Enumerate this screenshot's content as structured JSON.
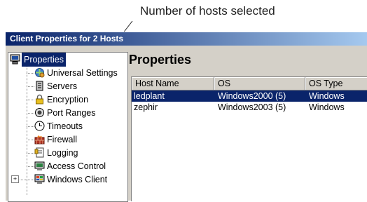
{
  "callout": {
    "text": "Number of hosts selected"
  },
  "window": {
    "title": "Client Properties for 2 Hosts"
  },
  "tree": {
    "items": [
      {
        "label": "Properties",
        "icon": "computer-icon"
      },
      {
        "label": "Universal Settings",
        "icon": "universal-settings-icon"
      },
      {
        "label": "Servers",
        "icon": "server-icon"
      },
      {
        "label": "Encryption",
        "icon": "lock-icon"
      },
      {
        "label": "Port Ranges",
        "icon": "port-icon"
      },
      {
        "label": "Timeouts",
        "icon": "clock-icon"
      },
      {
        "label": "Firewall",
        "icon": "firewall-icon"
      },
      {
        "label": "Logging",
        "icon": "log-icon"
      },
      {
        "label": "Access Control",
        "icon": "access-control-icon"
      },
      {
        "label": "Windows Client",
        "icon": "windows-client-icon",
        "expander": "+"
      }
    ]
  },
  "main": {
    "heading": "Properties",
    "columns": [
      "Host Name",
      "OS",
      "OS Type"
    ],
    "rows": [
      {
        "host": "ledplant",
        "os": "Windows2000 (5)",
        "os_type": "Windows"
      },
      {
        "host": "zephir",
        "os": "Windows2003 (5)",
        "os_type": "Windows"
      }
    ]
  },
  "colors": {
    "title_start": "#0a246a",
    "title_end": "#a6caf0",
    "selection": "#0a246a",
    "chrome": "#d4d0c8"
  }
}
